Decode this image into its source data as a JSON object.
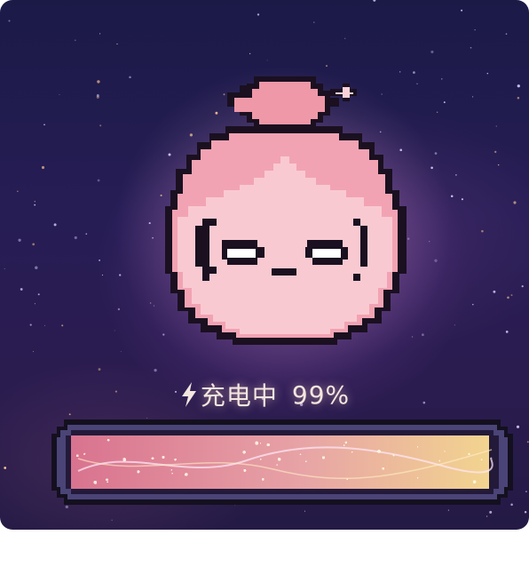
{
  "status": {
    "icon": "lightning-icon",
    "label": "充电中",
    "percent_text": "99%"
  },
  "battery": {
    "level": 0.99
  },
  "character": {
    "icon": "pixel-peach-character-icon"
  },
  "colors": {
    "background": "#231c4f",
    "character_pink": "#f3a8b7",
    "character_face": "#f9c9d1",
    "outline": "#1a1020",
    "bar_start": "#d9738f",
    "bar_end": "#f2d48f"
  }
}
